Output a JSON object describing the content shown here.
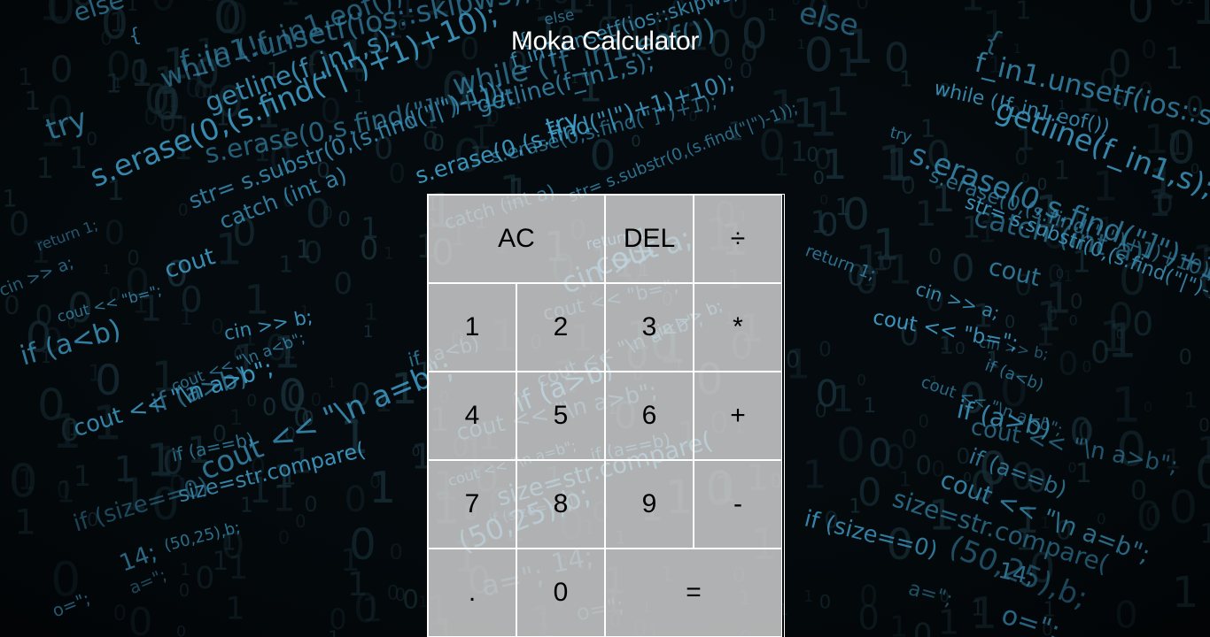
{
  "header": {
    "title": "Moka Calculator"
  },
  "calculator": {
    "buttons": {
      "ac": "AC",
      "del": "DEL",
      "divide": "÷",
      "one": "1",
      "two": "2",
      "three": "3",
      "multiply": "*",
      "four": "4",
      "five": "5",
      "six": "6",
      "plus": "+",
      "seven": "7",
      "eight": "8",
      "nine": "9",
      "minus": "-",
      "decimal": ".",
      "zero": "0",
      "equals": "="
    }
  },
  "background": {
    "code_snippets": [
      "else",
      "{",
      "f_in1.unsetf(ios::skipws);",
      "while (!f_in1.eof())",
      "getline(f_in1,s);",
      "try",
      "s.erase(0,s.find(\"]\")+1);",
      "s.erase(0,(s.find(\"|\")+1)+10);",
      "str= s.substr(0,(s.find(\"|\")-1));",
      "catch (int a)",
      "return 1;",
      "cout",
      "cin >> a;",
      "cout << \"b=\";",
      "cin >> b;",
      "if (a<b)",
      "cout << \"\\n a<b\";",
      "if (a>b)",
      "cout << \"\\n a>b\";",
      "if (a==b)",
      "cout << \"\\n a=b\";",
      "size=str.compare(",
      "if (size==0)",
      "(50,25),b;",
      "14;",
      "a=\";",
      "o=\";"
    ],
    "accent_color": "#4fc3f7",
    "digit_color": "#1e3a44"
  }
}
